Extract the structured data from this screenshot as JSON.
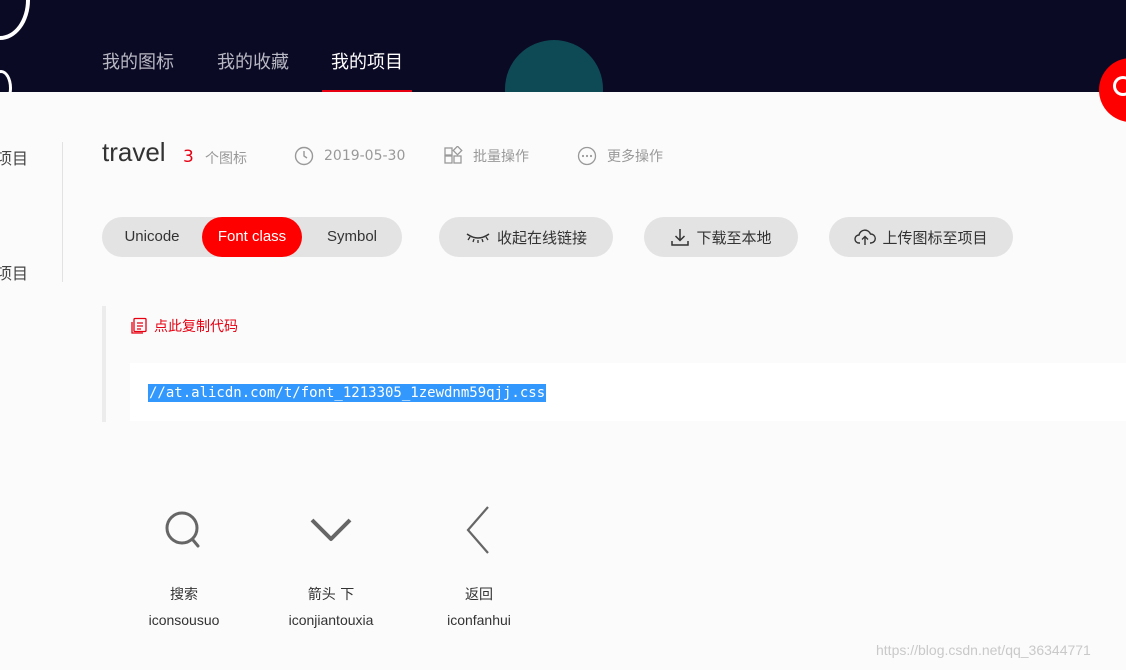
{
  "header": {
    "nav": [
      {
        "label": "我的图标",
        "active": false
      },
      {
        "label": "我的收藏",
        "active": false
      },
      {
        "label": "我的项目",
        "active": true
      }
    ],
    "accent_color": "#e60012",
    "background_color": "#0b0a24"
  },
  "sidebar": {
    "items": [
      {
        "label": "项目"
      },
      {
        "label": "项目"
      }
    ]
  },
  "project": {
    "title": "travel",
    "icon_count": "3",
    "icon_count_label": "个图标",
    "date": "2019-05-30",
    "batch_label": "批量操作",
    "more_label": "更多操作"
  },
  "format_tabs": [
    {
      "label": "Unicode",
      "active": false
    },
    {
      "label": "Font class",
      "active": true
    },
    {
      "label": "Symbol",
      "active": false
    }
  ],
  "actions": {
    "collapse_link": "收起在线链接",
    "download": "下载至本地",
    "upload": "上传图标至项目"
  },
  "code": {
    "copy_label": "点此复制代码",
    "url": "//at.alicdn.com/t/font_1213305_1zewdnm59qjj.css"
  },
  "icons": [
    {
      "name": "搜索",
      "class": "iconsousuo",
      "icon": "search-icon"
    },
    {
      "name": "箭头 下",
      "class": "iconjiantouxia",
      "icon": "chevron-down-icon"
    },
    {
      "name": "返回",
      "class": "iconfanhui",
      "icon": "chevron-left-icon"
    }
  ],
  "watermark": "https://blog.csdn.net/qq_36344771"
}
